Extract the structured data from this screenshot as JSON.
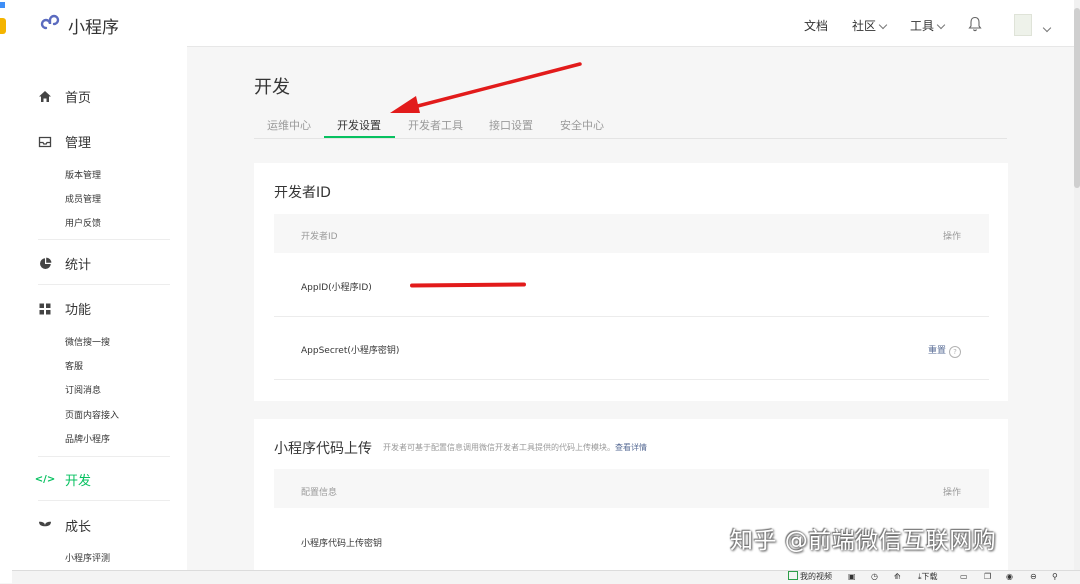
{
  "header": {
    "logo_text": "小程序",
    "nav": [
      {
        "label": "文档"
      },
      {
        "label": "社区"
      },
      {
        "label": "工具"
      }
    ]
  },
  "sidebar": {
    "home": "首页",
    "manage": "管理",
    "manage_items": [
      "版本管理",
      "成员管理",
      "用户反馈"
    ],
    "stats": "统计",
    "features": "功能",
    "feature_items": [
      "微信搜一搜",
      "客服",
      "订阅消息",
      "页面内容接入",
      "品牌小程序"
    ],
    "develop": "开发",
    "growth": "成长",
    "growth_items": [
      "小程序评测"
    ]
  },
  "main": {
    "title": "开发",
    "tabs": [
      "运维中心",
      "开发设置",
      "开发者工具",
      "接口设置",
      "安全中心"
    ],
    "active_tab": "开发设置",
    "dev_id_card": {
      "title": "开发者ID",
      "col_id": "开发者ID",
      "col_action": "操作",
      "appid_label": "AppID(小程序ID)",
      "appsecret_label": "AppSecret(小程序密钥)",
      "reset_label": "重置"
    },
    "upload_card": {
      "title": "小程序代码上传",
      "desc": "开发者可基于配置信息调用微信开发者工具提供的代码上传模块。",
      "link": "查看详情",
      "col_config": "配置信息",
      "col_action": "操作",
      "row_key": "小程序代码上传密钥"
    }
  },
  "watermark": "知乎 @前端微信互联网购",
  "statusbar": {
    "my_video": "我的视频",
    "download": "下载"
  },
  "colors": {
    "accent": "#07c160",
    "link": "#576b95",
    "annotation_red": "#e21b1b"
  }
}
